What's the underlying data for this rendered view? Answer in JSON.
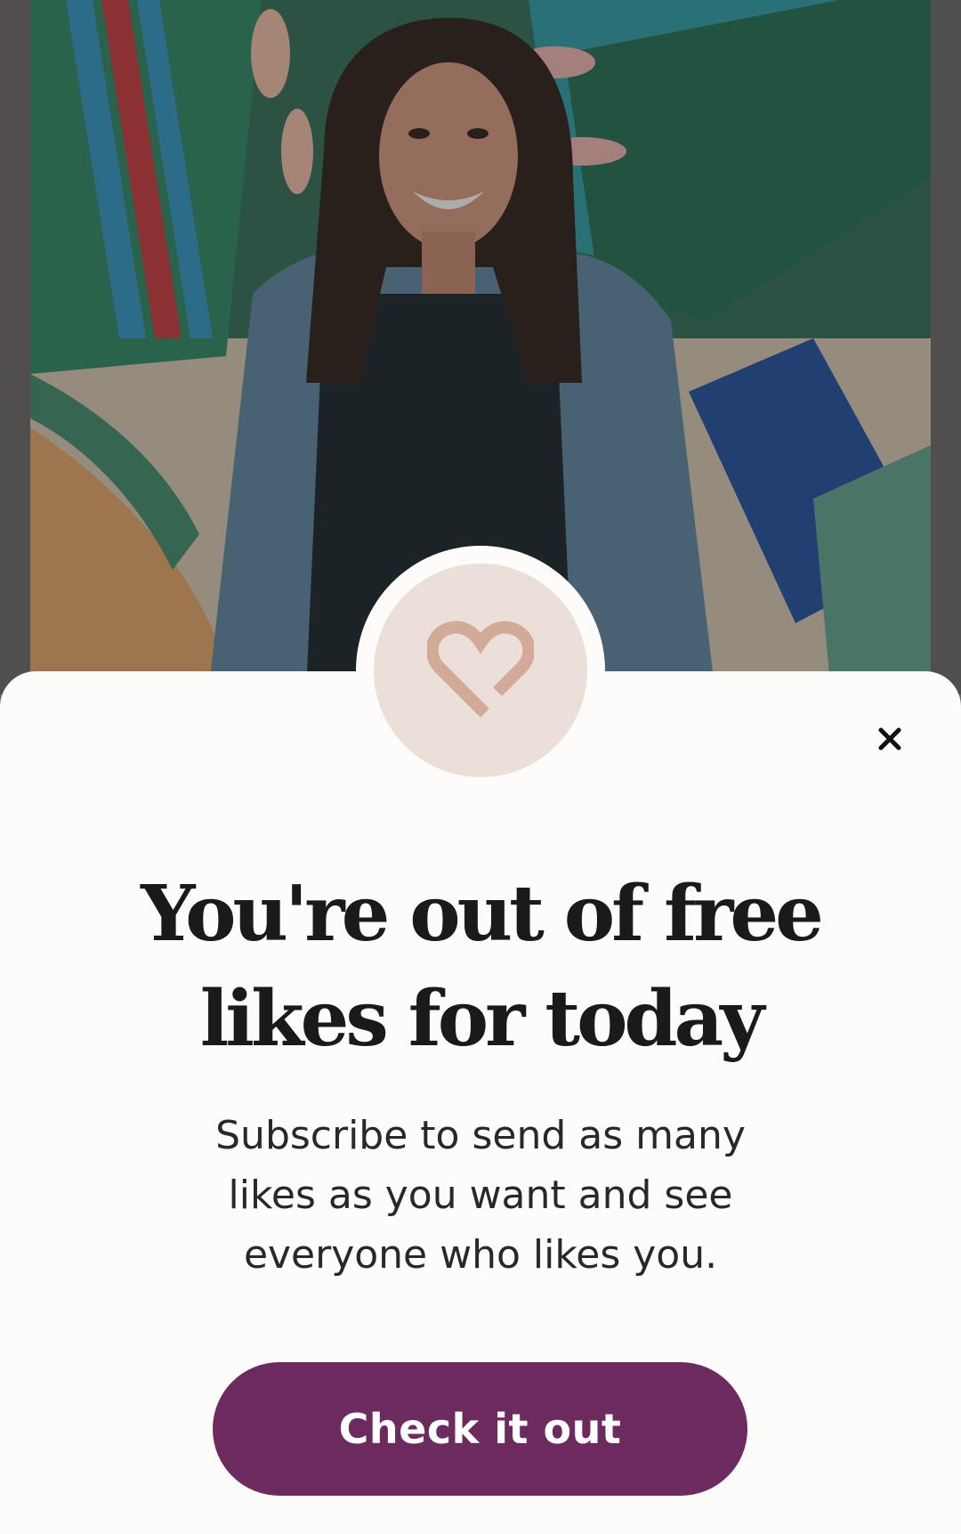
{
  "background": {
    "photo_icon": "profile-photo"
  },
  "paywall": {
    "badge_icon": "heart-icon",
    "close_icon": "close-icon",
    "headline_line1": "You're out of free",
    "headline_line2": "likes for today",
    "body_line1": "Subscribe to send as many",
    "body_line2": "likes as you want and see",
    "body_line3": "everyone who likes you.",
    "cta_label": "Check it out"
  },
  "colors": {
    "accent": "#6c2a5f",
    "badge_fill": "#ecdfd9",
    "badge_heart": "#d2ab98",
    "sheet_bg": "#fdfcfb",
    "text_primary": "#1c1a19"
  }
}
